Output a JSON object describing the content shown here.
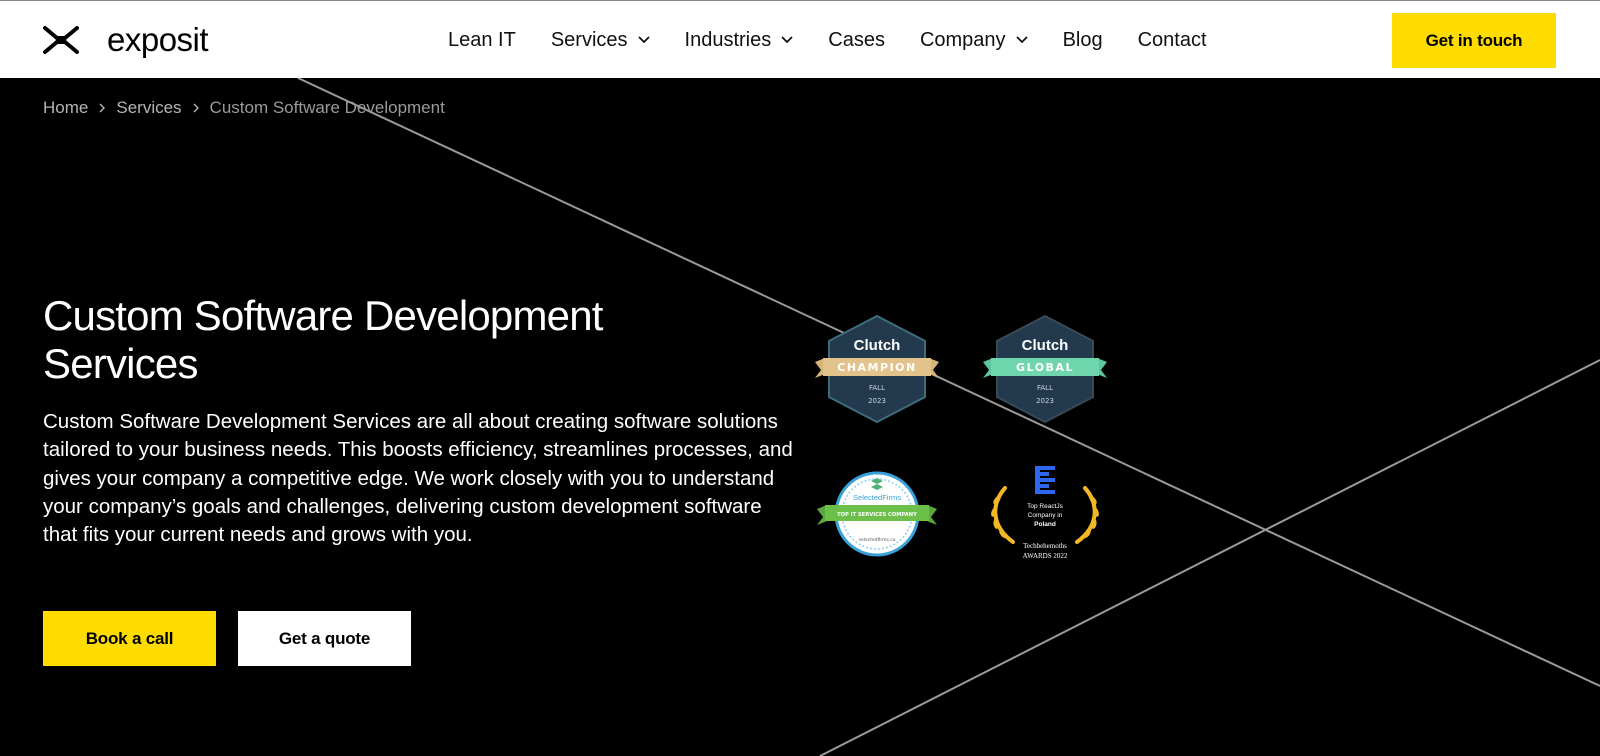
{
  "header": {
    "logo_text": "exposit",
    "nav": [
      {
        "label": "Lean IT",
        "dropdown": false
      },
      {
        "label": "Services",
        "dropdown": true
      },
      {
        "label": "Industries",
        "dropdown": true
      },
      {
        "label": "Cases",
        "dropdown": false
      },
      {
        "label": "Company",
        "dropdown": true
      },
      {
        "label": "Blog",
        "dropdown": false
      },
      {
        "label": "Contact",
        "dropdown": false
      }
    ],
    "cta_label": "Get in touch"
  },
  "breadcrumb": {
    "items": [
      "Home",
      "Services"
    ],
    "current": "Custom Software Development"
  },
  "hero": {
    "title": "Custom Software Development Services",
    "description": "Custom Software Development Services are all about creating software solutions tailored to your business needs. This boosts efficiency, streamlines processes, and gives your company a competitive edge. We work closely with you to understand your company’s goals and challenges, delivering custom development software that fits your current needs and grows with you.",
    "book_label": "Book a call",
    "quote_label": "Get a quote"
  },
  "badges": {
    "clutch_champion": {
      "brand": "Clutch",
      "ribbon": "CHAMPION",
      "season": "FALL",
      "year": "2023"
    },
    "clutch_global": {
      "brand": "Clutch",
      "ribbon": "GLOBAL",
      "season": "FALL",
      "year": "2023"
    },
    "selectedfirms": {
      "brand": "SelectedFirms",
      "ribbon": "TOP IT SERVICES COMPANY",
      "site": "selectedfirms.co"
    },
    "techbehemoths": {
      "line1": "Top ReactJs",
      "line2": "Company in",
      "line3": "Poland",
      "org": "Techbehemoths",
      "award": "AWARDS 2022"
    }
  },
  "colors": {
    "accent": "#ffdc00",
    "background": "#000000",
    "header_bg": "#ffffff"
  }
}
